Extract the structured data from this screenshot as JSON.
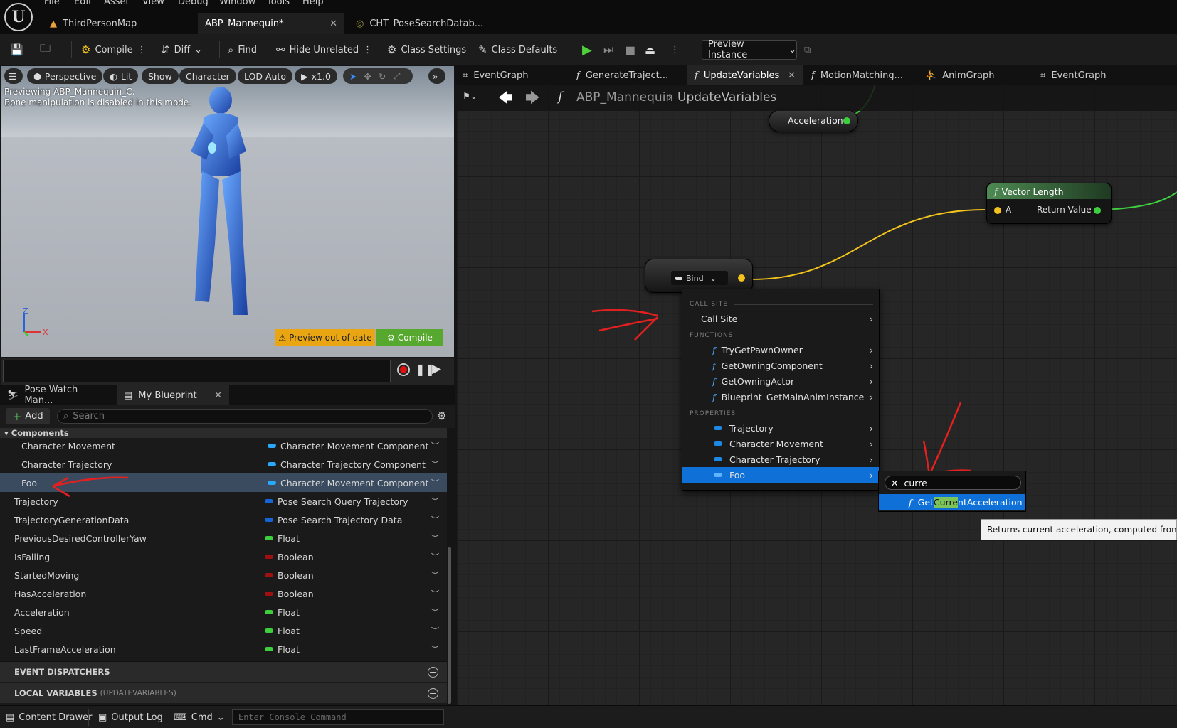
{
  "menu": [
    "File",
    "Edit",
    "Asset",
    "View",
    "Debug",
    "Window",
    "Tools",
    "Help"
  ],
  "doc_tabs": [
    {
      "label": "ThirdPersonMap",
      "closable": false
    },
    {
      "label": "ABP_Mannequin*",
      "closable": true
    },
    {
      "label": "CHT_PoseSearchDatab...",
      "closable": false
    }
  ],
  "toolbar": {
    "compile": "Compile",
    "diff": "Diff",
    "find": "Find",
    "hide_unrelated": "Hide Unrelated",
    "class_settings": "Class Settings",
    "class_defaults": "Class Defaults",
    "preview_instance": "Preview Instance"
  },
  "viewport": {
    "buttons": [
      "Perspective",
      "Lit",
      "Show",
      "Character",
      "LOD Auto",
      "x1.0"
    ],
    "info_line1": "Previewing ABP_Mannequin_C.",
    "info_line2": "Bone manipulation is disabled in this mode.",
    "preview_out_of_date": "Preview out of date",
    "compile": "Compile",
    "axis_z": "Z",
    "axis_x": "X"
  },
  "panel_tabs": [
    {
      "label": "Pose Watch Man..."
    },
    {
      "label": "My Blueprint"
    }
  ],
  "my_blueprint": {
    "add": "Add",
    "search_placeholder": "Search",
    "components_header": "Components",
    "rows": [
      {
        "name": "Character Movement",
        "type": "Character Movement Component",
        "color": "#29a8ff"
      },
      {
        "name": "Character Trajectory",
        "type": "Character Trajectory Component",
        "color": "#29a8ff"
      },
      {
        "name": "Foo",
        "type": "Character Movement Component",
        "color": "#29a8ff"
      },
      {
        "name": "Trajectory",
        "type": "Pose Search Query Trajectory",
        "color": "#1565d8"
      },
      {
        "name": "TrajectoryGenerationData",
        "type": "Pose Search Trajectory Data",
        "color": "#1565d8"
      },
      {
        "name": "PreviousDesiredControllerYaw",
        "type": "Float",
        "color": "#3ecf3e"
      },
      {
        "name": "IsFalling",
        "type": "Boolean",
        "color": "#a01010"
      },
      {
        "name": "StartedMoving",
        "type": "Boolean",
        "color": "#a01010"
      },
      {
        "name": "HasAcceleration",
        "type": "Boolean",
        "color": "#a01010"
      },
      {
        "name": "Acceleration",
        "type": "Float",
        "color": "#3ecf3e"
      },
      {
        "name": "Speed",
        "type": "Float",
        "color": "#3ecf3e"
      },
      {
        "name": "LastFrameAcceleration",
        "type": "Float",
        "color": "#3ecf3e"
      }
    ],
    "event_dispatchers": "EVENT DISPATCHERS",
    "local_variables": "LOCAL VARIABLES",
    "local_variables_scope": "(UPDATEVARIABLES)"
  },
  "bottom": {
    "content_drawer": "Content Drawer",
    "output_log": "Output Log",
    "cmd": "Cmd",
    "console_placeholder": "Enter Console Command"
  },
  "graph_tabs": [
    {
      "label": "EventGraph",
      "icon": "graph"
    },
    {
      "label": "GenerateTraject...",
      "icon": "f"
    },
    {
      "label": "UpdateVariables",
      "icon": "f",
      "active": true
    },
    {
      "label": "MotionMatching...",
      "icon": "f"
    },
    {
      "label": "AnimGraph",
      "icon": "anim"
    },
    {
      "label": "EventGraph",
      "icon": "graph"
    }
  ],
  "breadcrumb": {
    "root": "ABP_Mannequin",
    "current": "UpdateVariables"
  },
  "nodes": {
    "acceleration": "Acceleration",
    "vector_length": {
      "title": "Vector Length",
      "pin_a": "A",
      "return": "Return Value"
    },
    "bind": "Bind"
  },
  "context_menu": {
    "call_site_header": "CALL SITE",
    "call_site": "Call Site",
    "functions_header": "FUNCTIONS",
    "functions": [
      "TryGetPawnOwner",
      "GetOwningComponent",
      "GetOwningActor",
      "Blueprint_GetMainAnimInstance"
    ],
    "properties_header": "PROPERTIES",
    "properties": [
      "Trajectory",
      "Character Movement",
      "Character Trajectory",
      "Foo"
    ]
  },
  "submenu": {
    "search_value": "curre",
    "result_pre": "Get",
    "result_match": "Curre",
    "result_post": "ntAcceleration"
  },
  "tooltip": "Returns current acceleration, computed from input",
  "colors": {
    "accent": "#0f70d7",
    "annotation": "#e32020",
    "float_pin": "#3ecf3e",
    "vector_pin": "#f2c31c"
  }
}
